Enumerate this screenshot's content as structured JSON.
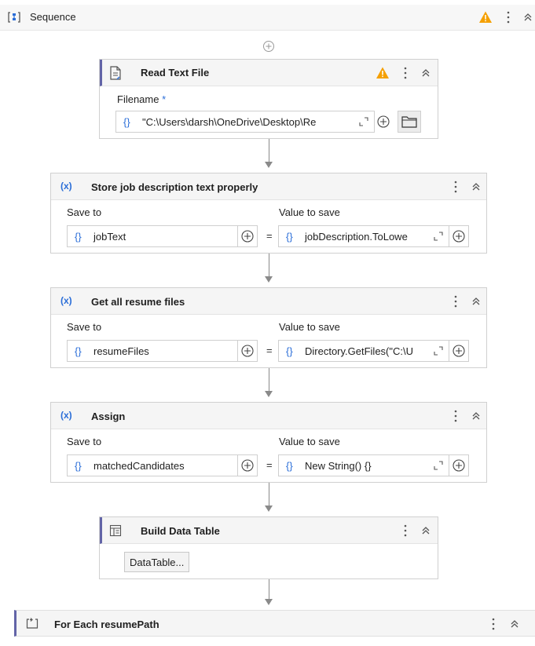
{
  "sequence": {
    "title": "Sequence"
  },
  "read_text_file": {
    "title": "Read Text File",
    "filename_label": "Filename",
    "required_mark": "*",
    "filename_value": "\"C:\\Users\\darsh\\OneDrive\\Desktop\\Re"
  },
  "braces_glyph": "{}",
  "equals": "=",
  "assign_badge": "(x)",
  "assigns": [
    {
      "title": "Store job description text properly",
      "save_to_label": "Save to",
      "value_label": "Value to save",
      "save_to": "jobText",
      "value": "jobDescription.ToLowe"
    },
    {
      "title": "Get all resume files",
      "save_to_label": "Save to",
      "value_label": "Value to save",
      "save_to": "resumeFiles",
      "value": "Directory.GetFiles(\"C:\\U"
    },
    {
      "title": "Assign",
      "save_to_label": "Save to",
      "value_label": "Value to save",
      "save_to": "matchedCandidates",
      "value": "New String() {}"
    }
  ],
  "build_data_table": {
    "title": "Build Data Table",
    "button": "DataTable..."
  },
  "for_each": {
    "title": "For Each resumePath"
  },
  "colors": {
    "accent": "#6264a7",
    "warning": "#f5a000",
    "link_blue": "#2b6ed8"
  },
  "icons": [
    "sequence-icon",
    "warning-icon",
    "more-icon",
    "collapse-icon",
    "add-icon",
    "file-read-icon",
    "folder-icon",
    "expand-icon",
    "data-table-icon",
    "for-each-icon"
  ]
}
